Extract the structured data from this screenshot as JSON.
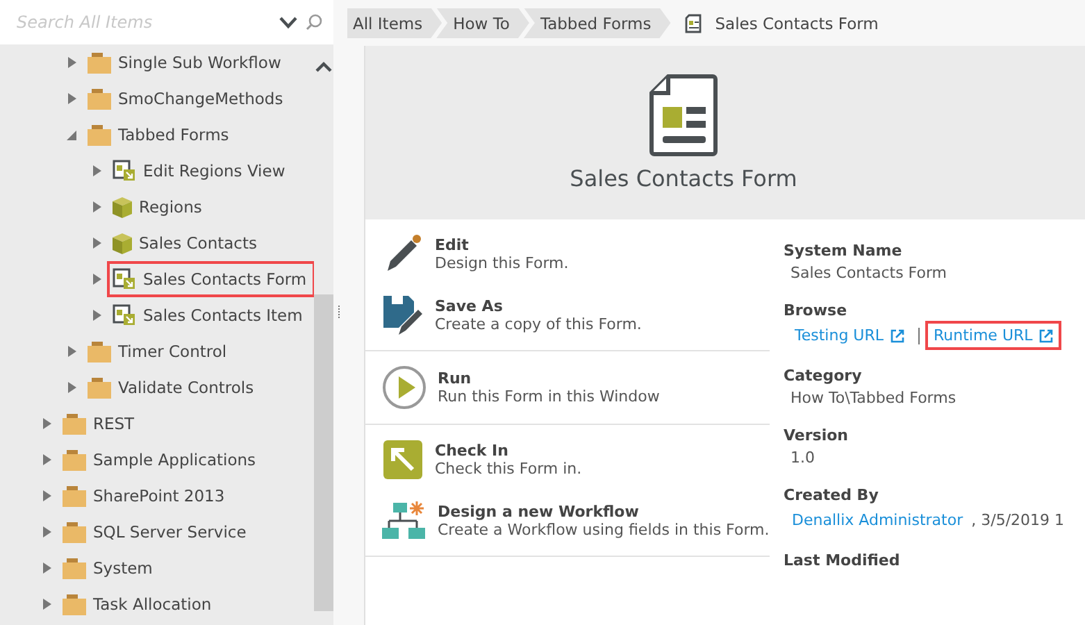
{
  "search": {
    "placeholder": "Search All Items"
  },
  "tree": {
    "nested_items": [
      {
        "label": "Single Sub Workflow",
        "kind": "folder",
        "expanded": false,
        "selected": false
      },
      {
        "label": "SmoChangeMethods",
        "kind": "folder",
        "expanded": false,
        "selected": false
      },
      {
        "label": "Tabbed Forms",
        "kind": "folder",
        "expanded": true,
        "selected": false,
        "children": [
          {
            "label": "Edit Regions View",
            "kind": "view",
            "expanded": false,
            "selected": false
          },
          {
            "label": "Regions",
            "kind": "smartobject",
            "expanded": false,
            "selected": false
          },
          {
            "label": "Sales Contacts",
            "kind": "smartobject",
            "expanded": false,
            "selected": false
          },
          {
            "label": "Sales Contacts Form",
            "kind": "form",
            "expanded": false,
            "selected": true
          },
          {
            "label": "Sales Contacts Item",
            "kind": "view",
            "expanded": false,
            "selected": false
          }
        ]
      },
      {
        "label": "Timer Control",
        "kind": "folder",
        "expanded": false,
        "selected": false
      },
      {
        "label": "Validate Controls",
        "kind": "folder",
        "expanded": false,
        "selected": false
      }
    ],
    "items": [
      {
        "label": "REST",
        "kind": "folder",
        "expanded": false,
        "selected": false
      },
      {
        "label": "Sample Applications",
        "kind": "folder",
        "expanded": false,
        "selected": false
      },
      {
        "label": "SharePoint 2013",
        "kind": "folder",
        "expanded": false,
        "selected": false
      },
      {
        "label": "SQL Server Service",
        "kind": "folder",
        "expanded": false,
        "selected": false
      },
      {
        "label": "System",
        "kind": "folder",
        "expanded": false,
        "selected": false
      },
      {
        "label": "Task Allocation",
        "kind": "folder",
        "expanded": false,
        "selected": false
      }
    ]
  },
  "breadcrumb": {
    "items": [
      "All Items",
      "How To",
      "Tabbed Forms"
    ],
    "current": "Sales Contacts Form"
  },
  "header": {
    "title": "Sales Contacts Form"
  },
  "action_groups": [
    [
      {
        "kind": "edit",
        "title": "Edit",
        "description": "Design this Form."
      },
      {
        "kind": "save",
        "title": "Save As",
        "description": "Create a copy of this Form."
      }
    ],
    [
      {
        "kind": "run",
        "title": "Run",
        "description": "Run this Form in this Window"
      }
    ],
    [
      {
        "kind": "checkin",
        "title": "Check In",
        "description": "Check this Form in."
      },
      {
        "kind": "workflow",
        "title": "Design a new Workflow",
        "description": "Create a Workflow using fields in this Form."
      }
    ]
  ],
  "details": [
    {
      "kind": "text",
      "label": "System Name",
      "value": "Sales Contacts Form"
    },
    {
      "kind": "links",
      "label": "Browse",
      "links": [
        {
          "text": "Testing URL",
          "selected": false
        },
        {
          "text": "Runtime URL",
          "selected": true
        }
      ]
    },
    {
      "kind": "text",
      "label": "Category",
      "value": "How To\\Tabbed Forms"
    },
    {
      "kind": "text",
      "label": "Version",
      "value": "1.0"
    },
    {
      "kind": "user",
      "label": "Created By",
      "user": "Denallix Administrator",
      "value": ", 3/5/2019 1"
    },
    {
      "kind": "text",
      "label": "Last Modified"
    }
  ]
}
